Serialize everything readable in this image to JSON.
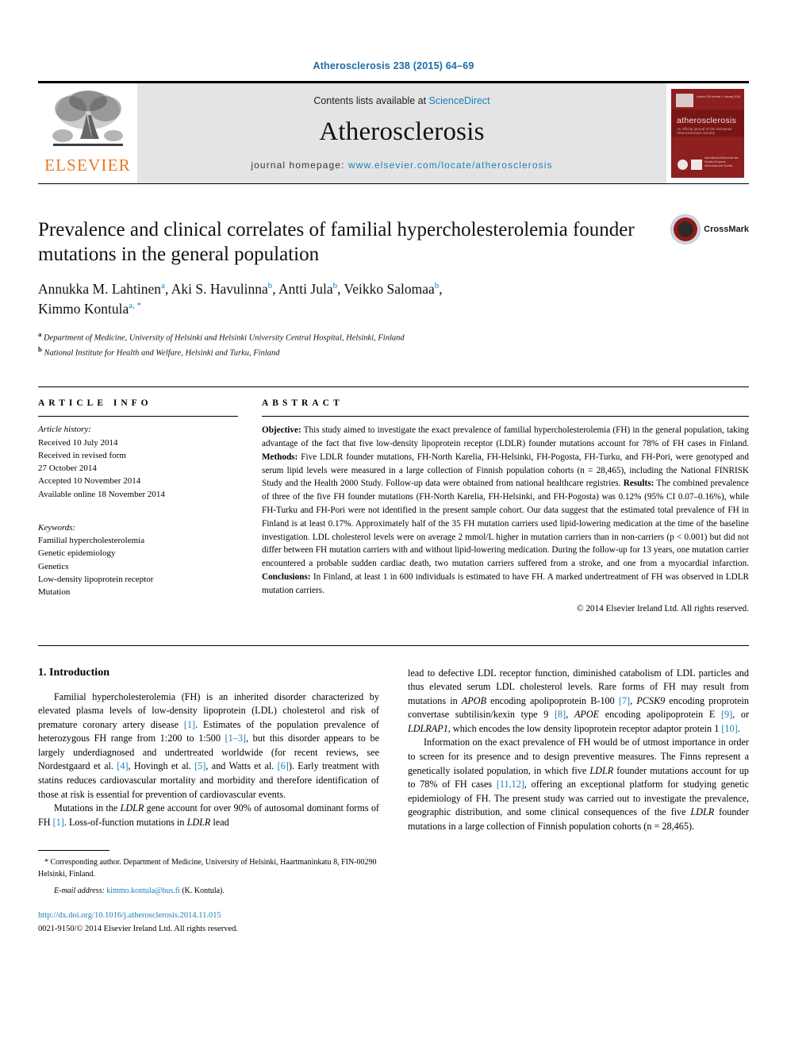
{
  "running_head": "Atherosclerosis 238 (2015) 64–69",
  "masthead": {
    "publisher_name": "ELSEVIER",
    "contents_prefix": "Contents lists available at ",
    "contents_link": "ScienceDirect",
    "journal_name": "Atherosclerosis",
    "homepage_prefix": "journal homepage: ",
    "homepage_url": "www.elsevier.com/locate/atherosclerosis",
    "cover": {
      "title": "atherosclerosis",
      "subtitle": "An official journal of the European Atherosclerosis Society",
      "top_line": "Volume 238  Number 1  January 2015",
      "footer": "International Atherosclerosis Society\nEuropean Atherosclerosis Society"
    }
  },
  "article": {
    "title": "Prevalence and clinical correlates of familial hypercholesterolemia founder mutations in the general population",
    "authors_line1": "Annukka M. Lahtinen",
    "authors": [
      {
        "name": "Annukka M. Lahtinen",
        "marks": "a"
      },
      {
        "name": "Aki S. Havulinna",
        "marks": "b"
      },
      {
        "name": "Antti Jula",
        "marks": "b"
      },
      {
        "name": "Veikko Salomaa",
        "marks": "b"
      },
      {
        "name": "Kimmo Kontula",
        "marks": "a, *"
      }
    ],
    "affiliations": [
      {
        "mark": "a",
        "text": "Department of Medicine, University of Helsinki and Helsinki University Central Hospital, Helsinki, Finland"
      },
      {
        "mark": "b",
        "text": "National Institute for Health and Welfare, Helsinki and Turku, Finland"
      }
    ],
    "crossmark_label": "CrossMark"
  },
  "article_info": {
    "heading": "ARTICLE INFO",
    "history_label": "Article history:",
    "history": [
      "Received 10 July 2014",
      "Received in revised form",
      "27 October 2014",
      "Accepted 10 November 2014",
      "Available online 18 November 2014"
    ],
    "keywords_label": "Keywords:",
    "keywords": [
      "Familial hypercholesterolemia",
      "Genetic epidemiology",
      "Genetics",
      "Low-density lipoprotein receptor",
      "Mutation"
    ]
  },
  "abstract": {
    "heading": "ABSTRACT",
    "objective_label": "Objective:",
    "objective_text": " This study aimed to investigate the exact prevalence of familial hypercholesterolemia (FH) in the general population, taking advantage of the fact that five low-density lipoprotein receptor (LDLR) founder mutations account for 78% of FH cases in Finland. ",
    "methods_label": "Methods:",
    "methods_text": " Five LDLR founder mutations, FH-North Karelia, FH-Helsinki, FH-Pogosta, FH-Turku, and FH-Pori, were genotyped and serum lipid levels were measured in a large collection of Finnish population cohorts (n = 28,465), including the National FINRISK Study and the Health 2000 Study. Follow-up data were obtained from national healthcare registries. ",
    "results_label": "Results:",
    "results_text": " The combined prevalence of three of the five FH founder mutations (FH-North Karelia, FH-Helsinki, and FH-Pogosta) was 0.12% (95% CI 0.07–0.16%), while FH-Turku and FH-Pori were not identified in the present sample cohort. Our data suggest that the estimated total prevalence of FH in Finland is at least 0.17%. Approximately half of the 35 FH mutation carriers used lipid-lowering medication at the time of the baseline investigation. LDL cholesterol levels were on average 2 mmol/L higher in mutation carriers than in non-carriers (p < 0.001) but did not differ between FH mutation carriers with and without lipid-lowering medication. During the follow-up for 13 years, one mutation carrier encountered a probable sudden cardiac death, two mutation carriers suffered from a stroke, and one from a myocardial infarction. ",
    "conclusions_label": "Conclusions:",
    "conclusions_text": " In Finland, at least 1 in 600 individuals is estimated to have FH. A marked undertreatment of FH was observed in LDLR mutation carriers.",
    "copyright": "© 2014 Elsevier Ireland Ltd. All rights reserved."
  },
  "introduction": {
    "heading": "1. Introduction",
    "p1_a": "Familial hypercholesterolemia (FH) is an inherited disorder characterized by elevated plasma levels of low-density lipoprotein (LDL) cholesterol and risk of premature coronary artery disease ",
    "p1_r1": "[1]",
    "p1_b": ". Estimates of the population prevalence of heterozygous FH range from 1:200 to 1:500 ",
    "p1_r2": "[1–3]",
    "p1_c": ", but this disorder appears to be largely underdiagnosed and undertreated worldwide (for recent reviews, see Nordestgaard et al. ",
    "p1_r3": "[4]",
    "p1_d": ", Hovingh et al. ",
    "p1_r4": "[5]",
    "p1_e": ", and Watts et al. ",
    "p1_r5": "[6]",
    "p1_f": "). Early treatment with statins reduces cardiovascular mortality and morbidity and therefore identification of those at risk is essential for prevention of cardiovascular events.",
    "p2_a": "Mutations in the ",
    "p2_gene1": "LDLR",
    "p2_b": " gene account for over 90% of autosomal dominant forms of FH ",
    "p2_r1": "[1]",
    "p2_c": ". Loss-of-function mutations in ",
    "p2_gene2": "LDLR",
    "p2_d": " lead to defective LDL receptor function, diminished catabolism of LDL particles and thus elevated serum LDL cholesterol levels. Rare forms of FH may result from mutations in ",
    "p2_gene3": "APOB",
    "p2_e": " encoding apolipoprotein B-100 ",
    "p2_r2": "[7]",
    "p2_f": ", ",
    "p2_gene4": "PCSK9",
    "p2_g": " encoding proprotein convertase subtilisin/kexin type 9 ",
    "p2_r3": "[8]",
    "p2_h": ", ",
    "p2_gene5": "APOE",
    "p2_i": " encoding apolipoprotein E ",
    "p2_r4": "[9]",
    "p2_j": ", or ",
    "p2_gene6": "LDLRAP1",
    "p2_k": ", which encodes the low density lipoprotein receptor adaptor protein 1 ",
    "p2_r5": "[10]",
    "p2_l": ".",
    "p3_a": "Information on the exact prevalence of FH would be of utmost importance in order to screen for its presence and to design preventive measures. The Finns represent a genetically isolated population, in which five ",
    "p3_gene1": "LDLR",
    "p3_b": " founder mutations account for up to 78% of FH cases ",
    "p3_r1": "[11,12]",
    "p3_c": ", offering an exceptional platform for studying genetic epidemiology of FH. The present study was carried out to investigate the prevalence, geographic distribution, and some clinical consequences of the five ",
    "p3_gene2": "LDLR",
    "p3_d": " founder mutations in a large collection of Finnish population cohorts (n = 28,465)."
  },
  "footnote": {
    "corr_mark": "*",
    "corr_text": " Corresponding author. Department of Medicine, University of Helsinki, Haartmaninkatu 8, FIN-00290 Helsinki, Finland.",
    "email_label": "E-mail address:",
    "email": "kimmo.kontula@hus.fi",
    "email_suffix": " (K. Kontula).",
    "doi": "http://dx.doi.org/10.1016/j.atherosclerosis.2014.11.015",
    "issn_line": "0021-9150/© 2014 Elsevier Ireland Ltd. All rights reserved."
  },
  "colors": {
    "link_blue": "#1b7fb5",
    "elsevier_orange": "#E87722",
    "cover_red": "#8d1f1f",
    "masthead_grey": "#e4e4e4"
  }
}
